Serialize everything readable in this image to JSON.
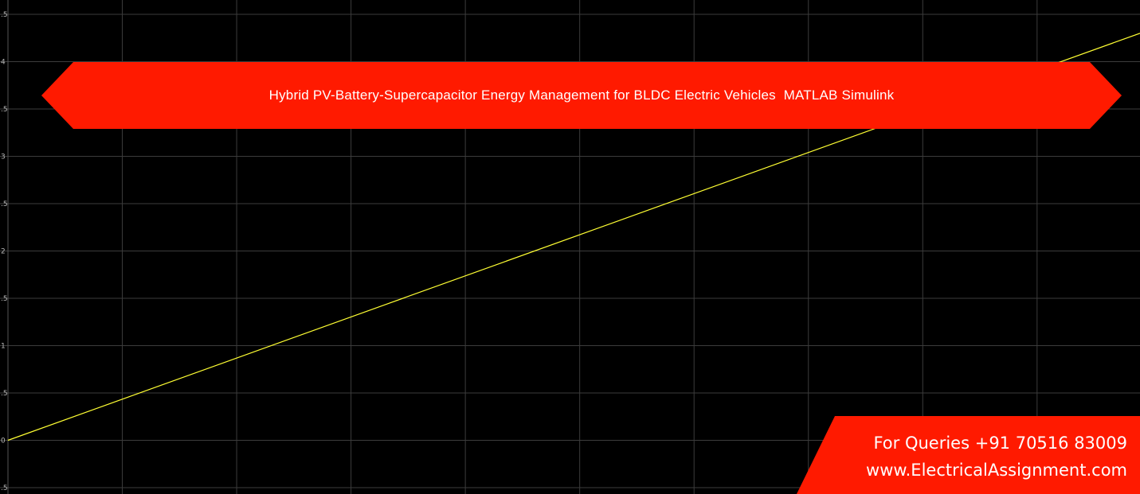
{
  "chart_data": {
    "type": "line",
    "ylim": [
      -0.5,
      4.5
    ],
    "xlim": [
      0,
      1
    ],
    "yticks": [
      {
        "value": -0.5,
        "label": ".5"
      },
      {
        "value": 0,
        "label": "0"
      },
      {
        "value": 0.5,
        "label": ".5"
      },
      {
        "value": 1,
        "label": "1"
      },
      {
        "value": 1.5,
        "label": ".5"
      },
      {
        "value": 2,
        "label": "2"
      },
      {
        "value": 2.5,
        "label": ".5"
      },
      {
        "value": 3,
        "label": "3"
      },
      {
        "value": 3.5,
        "label": ".5"
      },
      {
        "value": 4,
        "label": "4"
      },
      {
        "value": 4.5,
        "label": ".5"
      }
    ],
    "grid": true,
    "series": [
      {
        "color": "#ffff33",
        "x": [
          0,
          1
        ],
        "y": [
          0,
          4.3
        ]
      }
    ],
    "colors": {
      "background": "#000000",
      "grid": "#3c3c3c",
      "line": "#ffff33"
    }
  },
  "banner": {
    "title": "Hybrid PV-Battery-Supercapacitor Energy Management for BLDC Electric Vehicles  MATLAB Simulink",
    "color": "#ff1a00"
  },
  "contact": {
    "phone": "For Queries +91 70516 83009",
    "website": "www.ElectricalAssignment.com",
    "color": "#ff1a00"
  }
}
